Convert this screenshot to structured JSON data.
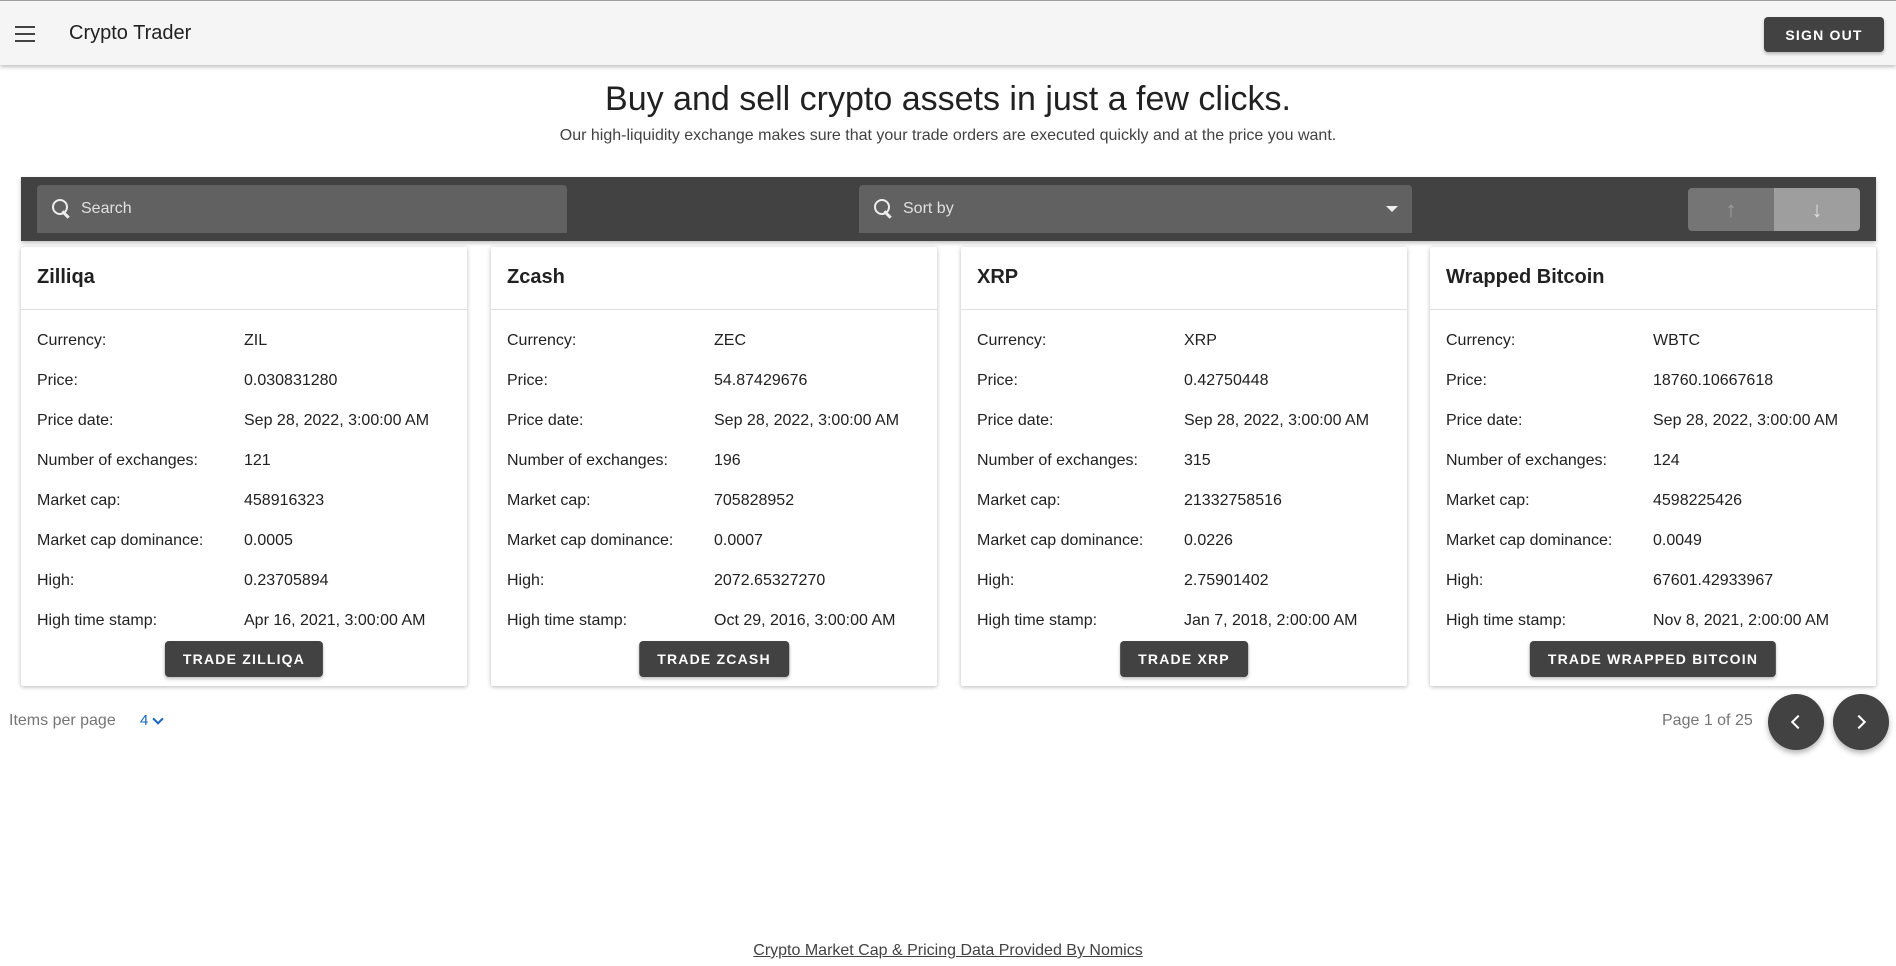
{
  "app": {
    "title": "Crypto Trader",
    "signout_label": "SIGN OUT"
  },
  "hero": {
    "title": "Buy and sell crypto assets in just a few clicks.",
    "subtitle": "Our high-liquidity exchange makes sure that your trade orders are executed quickly and at the price you want."
  },
  "toolbar": {
    "search_placeholder": "Search",
    "sort_placeholder": "Sort by",
    "sort_up_icon": "↑",
    "sort_down_icon": "↓"
  },
  "labels": {
    "currency": "Currency:",
    "price": "Price:",
    "price_date": "Price date:",
    "num_exchanges": "Number of exchanges:",
    "market_cap": "Market cap:",
    "market_cap_dominance": "Market cap dominance:",
    "high": "High:",
    "high_timestamp": "High time stamp:"
  },
  "cards": [
    {
      "name": "Zilliqa",
      "currency": "ZIL",
      "price": "0.030831280",
      "price_date": "Sep 28, 2022, 3:00:00 AM",
      "num_exchanges": "121",
      "market_cap": "458916323",
      "market_cap_dominance": "0.0005",
      "high": "0.23705894",
      "high_timestamp": "Apr 16, 2021, 3:00:00 AM",
      "trade_label": "TRADE ZILLIQA"
    },
    {
      "name": "Zcash",
      "currency": "ZEC",
      "price": "54.87429676",
      "price_date": "Sep 28, 2022, 3:00:00 AM",
      "num_exchanges": "196",
      "market_cap": "705828952",
      "market_cap_dominance": "0.0007",
      "high": "2072.65327270",
      "high_timestamp": "Oct 29, 2016, 3:00:00 AM",
      "trade_label": "TRADE ZCASH"
    },
    {
      "name": "XRP",
      "currency": "XRP",
      "price": "0.42750448",
      "price_date": "Sep 28, 2022, 3:00:00 AM",
      "num_exchanges": "315",
      "market_cap": "21332758516",
      "market_cap_dominance": "0.0226",
      "high": "2.75901402",
      "high_timestamp": "Jan 7, 2018, 2:00:00 AM",
      "trade_label": "TRADE XRP"
    },
    {
      "name": "Wrapped Bitcoin",
      "currency": "WBTC",
      "price": "18760.10667618",
      "price_date": "Sep 28, 2022, 3:00:00 AM",
      "num_exchanges": "124",
      "market_cap": "4598225426",
      "market_cap_dominance": "0.0049",
      "high": "67601.42933967",
      "high_timestamp": "Nov 8, 2021, 2:00:00 AM",
      "trade_label": "TRADE WRAPPED BITCOIN"
    }
  ],
  "pagination": {
    "items_per_page_label": "Items per page",
    "items_per_page_value": "4",
    "page_info": "Page 1 of 25"
  },
  "footer": {
    "link_text": "Crypto Market Cap & Pricing Data Provided By Nomics"
  }
}
